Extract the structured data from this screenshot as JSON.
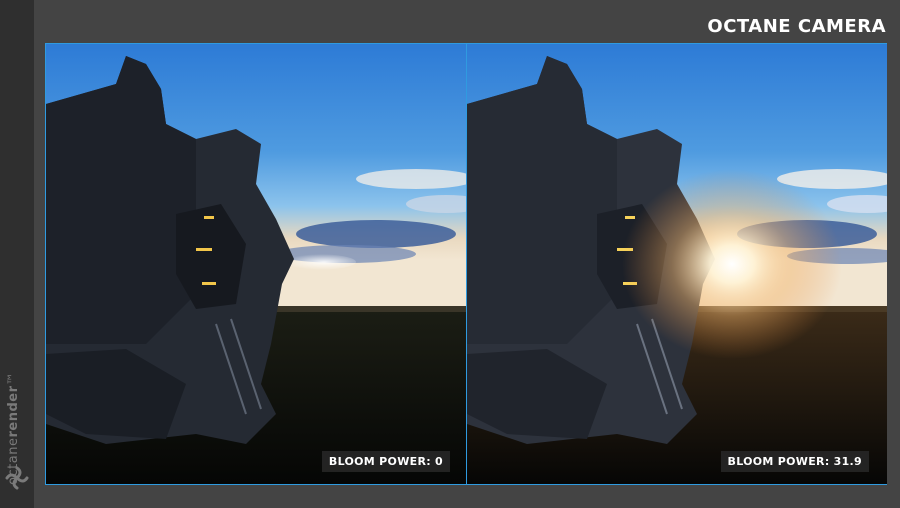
{
  "header": {
    "title": "OCTANE CAMERA"
  },
  "sidebar": {
    "logo_text_light": "octane",
    "logo_text_bold": "render",
    "logo_mark": "™"
  },
  "panels": [
    {
      "label": "BLOOM POWER: 0"
    },
    {
      "label": "BLOOM POWER: 31.9"
    }
  ],
  "colors": {
    "accent_border": "#2f9be0",
    "background": "#444444",
    "sidebar": "#2f2f2f"
  }
}
